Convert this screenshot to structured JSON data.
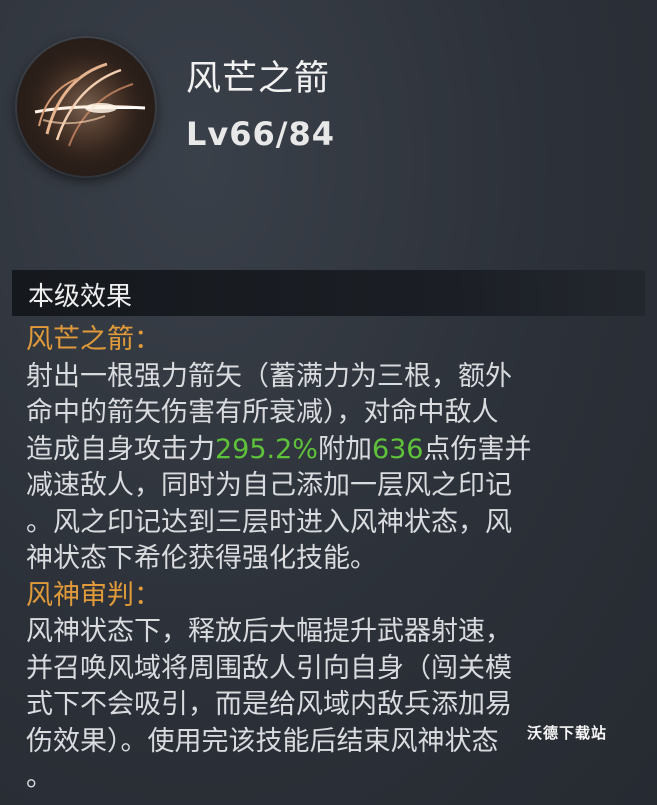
{
  "skill": {
    "name": "风芒之箭",
    "level": "Lv66/84"
  },
  "section": {
    "title": "本级效果"
  },
  "desc": {
    "head1": "风芒之箭：",
    "l1": "射出一根强力箭矢（蓄满力为三根，额外",
    "l2": "命中的箭矢伤害有所衰减），对命中敌人",
    "l3_pre": "造成自身攻击力",
    "l3_num1": "295.2%",
    "l3_mid": "附加",
    "l3_num2": "636",
    "l3_post": "点伤害并",
    "l4": "减速敌人，同时为自己添加一层风之印记",
    "l5": "。风之印记达到三层时进入风神状态，风",
    "l6": "神状态下希伦获得强化技能。",
    "head2": "风神审判：",
    "l7": "风神状态下，释放后大幅提升武器射速，",
    "l8": "并召唤风域将周围敌人引向自身（闯关模",
    "l9": "式下不会吸引，而是给风域内敌兵添加易",
    "l10": "伤效果）。使用完该技能后结束风神状态",
    "l11": "。"
  },
  "watermark": "沃德下载站",
  "colors": {
    "heading": "#e09a3a",
    "highlight_number": "#5ec23a",
    "background": "#2c3139"
  },
  "icons": {
    "skill": "wind-arrow-icon"
  }
}
